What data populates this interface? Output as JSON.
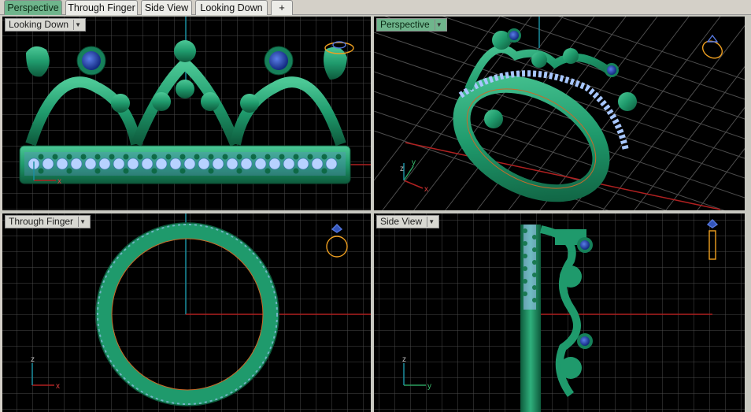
{
  "tabs": [
    {
      "label": "Perspective",
      "active": true
    },
    {
      "label": "Through Finger",
      "active": false
    },
    {
      "label": "Side View",
      "active": false
    },
    {
      "label": "Looking Down",
      "active": false
    }
  ],
  "add_tab_icon": "+",
  "viewports": {
    "top_left": {
      "label": "Looking Down",
      "active": false
    },
    "top_right": {
      "label": "Perspective",
      "active": true
    },
    "bottom_left": {
      "label": "Through Finger",
      "active": false
    },
    "bottom_right": {
      "label": "Side View",
      "active": false
    }
  },
  "axis_labels": {
    "top_left": {
      "x": "x"
    },
    "top_right": {
      "z": "z",
      "y": "y",
      "x": "x"
    },
    "bottom_left": {
      "z": "z",
      "x": "x"
    },
    "bottom_right": {
      "z": "z",
      "y": "y"
    }
  },
  "dropdown_icon": "chevron-down-icon",
  "colors": {
    "model_green": "#1f9a6c",
    "gem_blue": "#1d3c9e",
    "pave_light": "#a8c7ff",
    "grid_line": "#555555",
    "axis_red": "#b02020",
    "axis_cyan": "#1a8fa0",
    "orientation_gold": "#f0a020",
    "active_tab": "#6fb58c"
  }
}
